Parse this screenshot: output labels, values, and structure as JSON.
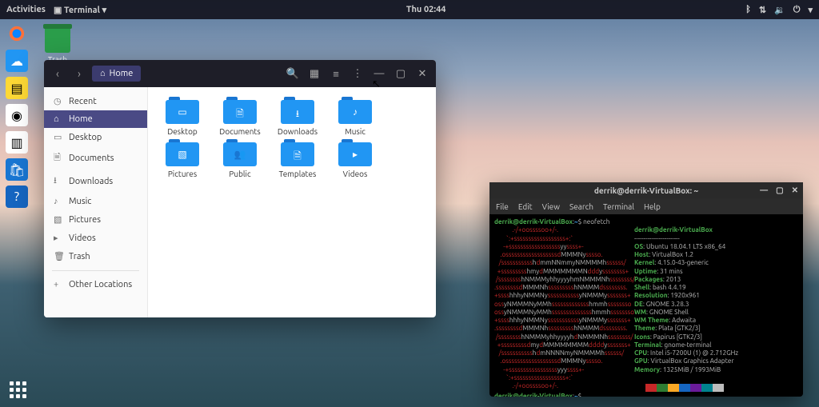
{
  "topbar": {
    "activities": "Activities",
    "appmenu": "Terminal ▾",
    "clock": "Thu 02:44"
  },
  "trash": {
    "label": "Trash"
  },
  "files": {
    "path_label": "Home",
    "sidebar": [
      {
        "icon": "◷",
        "label": "Recent"
      },
      {
        "icon": "⌂",
        "label": "Home",
        "active": true
      },
      {
        "icon": "▭",
        "label": "Desktop"
      },
      {
        "icon": "🗎",
        "label": "Documents"
      },
      {
        "icon": "⭳",
        "label": "Downloads"
      },
      {
        "icon": "♪",
        "label": "Music"
      },
      {
        "icon": "▧",
        "label": "Pictures"
      },
      {
        "icon": "▸",
        "label": "Videos"
      },
      {
        "icon": "🗑",
        "label": "Trash"
      }
    ],
    "other": "Other Locations",
    "folders": [
      {
        "name": "Desktop",
        "inner": "▭"
      },
      {
        "name": "Documents",
        "inner": "🗎"
      },
      {
        "name": "Downloads",
        "inner": "⭳"
      },
      {
        "name": "Music",
        "inner": "♪"
      },
      {
        "name": "Pictures",
        "inner": "▧"
      },
      {
        "name": "Public",
        "inner": "👥"
      },
      {
        "name": "Templates",
        "inner": "🗎"
      },
      {
        "name": "Videos",
        "inner": "▸"
      }
    ]
  },
  "terminal": {
    "title": "derrik@derrik-VirtualBox: ~",
    "menu": [
      "File",
      "Edit",
      "View",
      "Search",
      "Terminal",
      "Help"
    ],
    "prompt_user": "derrik@derrik-VirtualBox",
    "prompt_sep": ":",
    "prompt_path": "~",
    "prompt_end": "$ ",
    "cmd": "neofetch",
    "info_title": "derrik@derrik-VirtualBox",
    "info": [
      {
        "k": "OS",
        "v": "Ubuntu 18.04.1 LTS x86_64"
      },
      {
        "k": "Host",
        "v": "VirtualBox 1.2"
      },
      {
        "k": "Kernel",
        "v": "4.15.0-43-generic"
      },
      {
        "k": "Uptime",
        "v": "31 mins"
      },
      {
        "k": "Packages",
        "v": "2013"
      },
      {
        "k": "Shell",
        "v": "bash 4.4.19"
      },
      {
        "k": "Resolution",
        "v": "1920x961"
      },
      {
        "k": "DE",
        "v": "GNOME 3.28.3"
      },
      {
        "k": "WM",
        "v": "GNOME Shell"
      },
      {
        "k": "WM Theme",
        "v": "Adwaita"
      },
      {
        "k": "Theme",
        "v": "Plata [GTK2/3]"
      },
      {
        "k": "Icons",
        "v": "Papirus [GTK2/3]"
      },
      {
        "k": "Terminal",
        "v": "gnome-terminal"
      },
      {
        "k": "CPU",
        "v": "Intel i5-7200U (1) @ 2.712GHz"
      },
      {
        "k": "GPU",
        "v": "VirtualBox Graphics Adapter"
      },
      {
        "k": "Memory",
        "v": "1325MiB / 1993MiB"
      }
    ],
    "swatches": [
      "#000",
      "#c62828",
      "#2e7d32",
      "#f9a825",
      "#1565c0",
      "#6a1b9a",
      "#00838f",
      "#bdbdbd"
    ],
    "art": [
      "            .-/+oossssoo+/-.",
      "        `:+ssssssssssssssssss+:`",
      "      -+ssssssssssssssssssyyssss+-",
      "    .ossssssssssssssssssdMMMNysssso.",
      "   /ssssssssssshdmmNNmmyNMMMMhssssss/",
      "  +ssssssssshmydMMMMMMMNdddyssssssss+",
      " /sssssssshNMMMyhhyyyyhmNMMMNhssssssss/",
      ".ssssssssdMMMNhssssssssshNMMMdssssssss.",
      "+sssshhhyNMMNysssssssssssyNMMMysssssss+",
      "ossyNMMMNyMMhssssssssssssshmmhssssssso",
      "ossyNMMMNyMMhsssssssssssssshmmhssssssso",
      "+sssshhhyNMMNysssssssssssyNMMMysssssss+",
      ".ssssssssdMMMNhssssssssshNMMMdssssssss.",
      " /sssssssshNMMMyhhyyyyhdNMMMNhssssssss/",
      "  +sssssssssdmydMMMMMMMMddddysssssss+",
      "   /ssssssssssshdmNNNNmyNMMMMhssssss/",
      "    .ossssssssssssssssssdMMMNysssso.",
      "      -+sssssssssssssssssyyyssss+-",
      "        `:+ssssssssssssssssss+:`",
      "            .-/+oossssoo+/-."
    ]
  }
}
